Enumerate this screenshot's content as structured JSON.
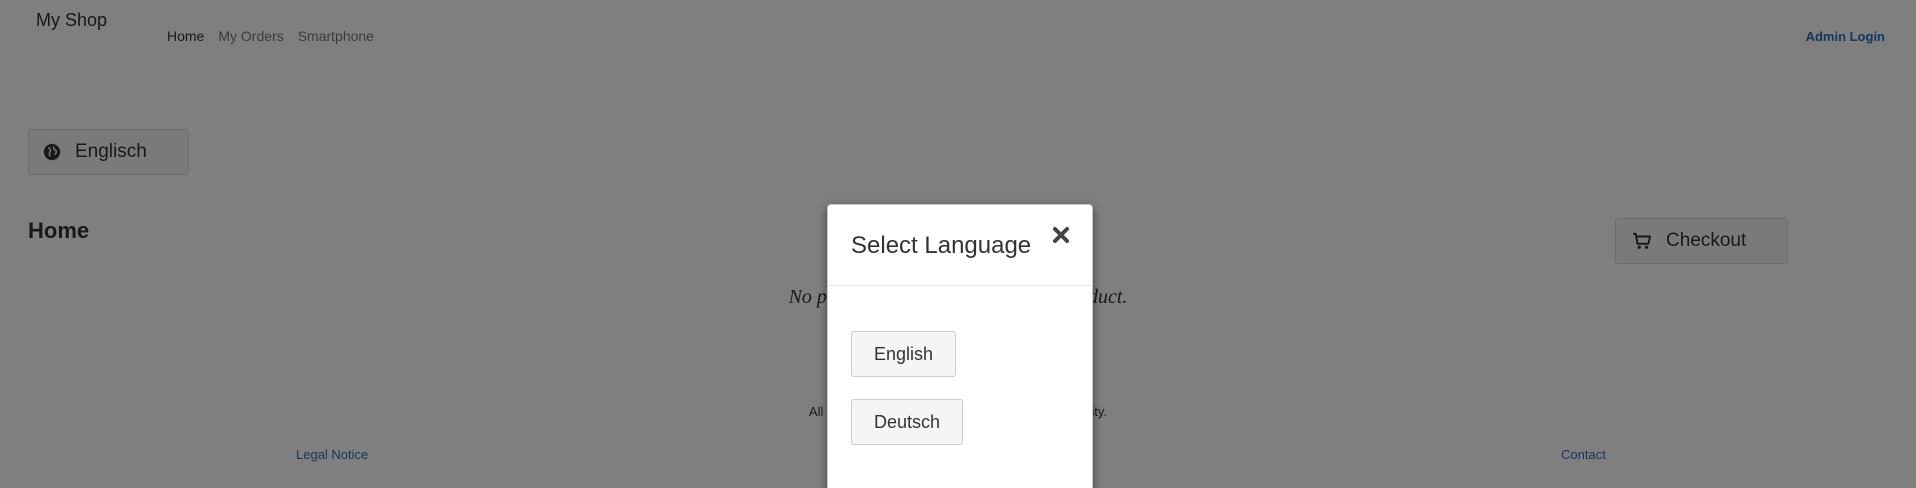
{
  "navbar": {
    "brand": "My Shop",
    "items": [
      {
        "label": "Home",
        "active": true
      },
      {
        "label": "My Orders",
        "active": false
      },
      {
        "label": "Smartphone",
        "active": false
      }
    ],
    "admin_login": "Admin Login"
  },
  "language_toggle": {
    "label": "Englisch",
    "icon": "globe-icon"
  },
  "main": {
    "title": "Home",
    "empty_message": "No products yet. Please request a product.",
    "checkout_label": "Checkout",
    "checkout_icon": "cart-icon"
  },
  "footer": {
    "rights_text": "All Rights Reserved. Products without any warranty.",
    "legal_notice": "Legal Notice",
    "contact": "Contact"
  },
  "modal": {
    "title": "Select Language",
    "close_icon": "close-icon",
    "options": [
      "English",
      "Deutsch"
    ]
  },
  "colors": {
    "link": "#2a6ebb",
    "backdrop": "rgba(0,0,0,0.5)"
  }
}
